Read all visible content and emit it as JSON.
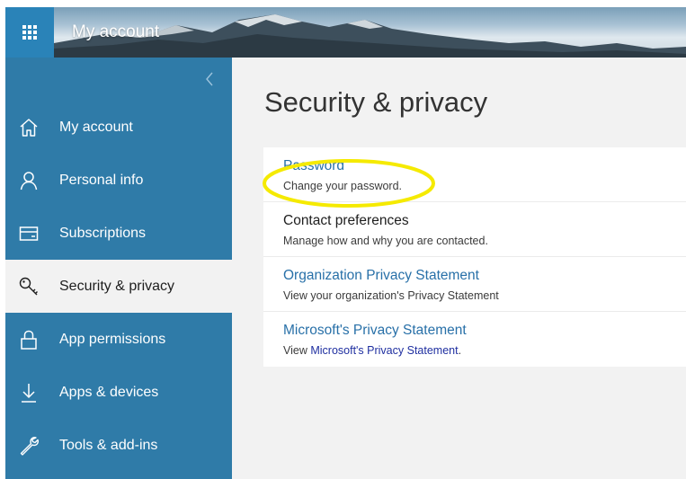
{
  "header": {
    "app_title": "My account",
    "launcher_icon": "app-launcher-icon"
  },
  "sidebar": {
    "collapse_icon": "chevron-left-icon",
    "items": [
      {
        "label": "My account",
        "icon": "home-icon",
        "active": false
      },
      {
        "label": "Personal info",
        "icon": "person-icon",
        "active": false
      },
      {
        "label": "Subscriptions",
        "icon": "card-icon",
        "active": false
      },
      {
        "label": "Security & privacy",
        "icon": "key-icon",
        "active": true
      },
      {
        "label": "App permissions",
        "icon": "lock-icon",
        "active": false
      },
      {
        "label": "Apps & devices",
        "icon": "download-icon",
        "active": false
      },
      {
        "label": "Tools & add-ins",
        "icon": "wrench-icon",
        "active": false
      }
    ]
  },
  "main": {
    "title": "Security & privacy",
    "cards": [
      {
        "title": "Password",
        "description": "Change your password."
      },
      {
        "title": "Contact preferences",
        "description": "Manage how and why you are contacted."
      },
      {
        "title": "Organization Privacy Statement",
        "description": "View your organization's Privacy Statement"
      },
      {
        "title": "Microsoft's Privacy Statement",
        "description_prefix": "View ",
        "description_link": "Microsoft's Privacy Statement",
        "description_suffix": "."
      }
    ]
  },
  "colors": {
    "sidebar": "#2f7ba8",
    "launcher": "#2a83b8",
    "link": "#2870a8",
    "highlight": "#f5ea00",
    "background": "#f2f2f2"
  }
}
